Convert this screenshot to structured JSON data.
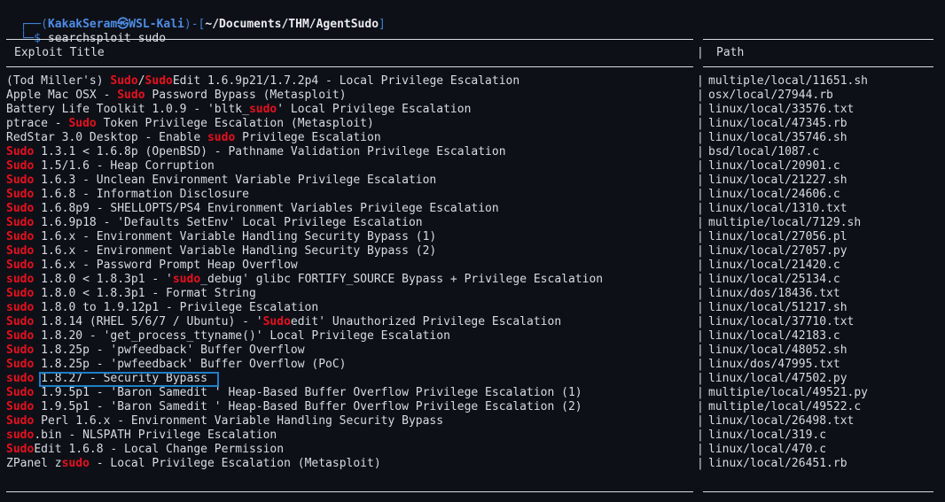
{
  "prompt": {
    "corner": "┌──(",
    "user": "KakakSeram",
    "at_glyph": "㉿",
    "host": "WSL-Kali",
    "mid": ")-[",
    "cwd": "~/Documents/THM/AgentSudo",
    "close": "]",
    "cmd_prefix": "└─$ ",
    "command": "searchsploit sudo"
  },
  "headers": {
    "title": "Exploit Title",
    "sep": "|",
    "path": "Path"
  },
  "rows": [
    {
      "parts": [
        [
          "(Tod Miller's) ",
          ""
        ],
        [
          "Sudo",
          "r"
        ],
        [
          "/",
          ""
        ],
        [
          "Sudo",
          "r"
        ],
        [
          "Edit 1.6.9p21/1.7.2p4 - Local Privilege Escalation",
          ""
        ]
      ],
      "path": "multiple/local/11651.sh"
    },
    {
      "parts": [
        [
          "Apple Mac OSX - ",
          ""
        ],
        [
          "Sudo",
          "r"
        ],
        [
          " Password Bypass (Metasploit)",
          ""
        ]
      ],
      "path": "osx/local/27944.rb"
    },
    {
      "parts": [
        [
          "Battery Life Toolkit 1.0.9 - 'bltk_",
          ""
        ],
        [
          "sudo",
          "r"
        ],
        [
          "' Local Privilege Escalation",
          ""
        ]
      ],
      "path": "linux/local/33576.txt"
    },
    {
      "parts": [
        [
          "ptrace - ",
          ""
        ],
        [
          "Sudo",
          "r"
        ],
        [
          " Token Privilege Escalation (Metasploit)",
          ""
        ]
      ],
      "path": "linux/local/47345.rb"
    },
    {
      "parts": [
        [
          "RedStar 3.0 Desktop - Enable ",
          ""
        ],
        [
          "sudo",
          "r"
        ],
        [
          " Privilege Escalation",
          ""
        ]
      ],
      "path": "linux/local/35746.sh"
    },
    {
      "parts": [
        [
          "Sudo",
          "r"
        ],
        [
          " 1.3.1 < 1.6.8p (OpenBSD) - Pathname Validation Privilege Escalation",
          ""
        ]
      ],
      "path": "bsd/local/1087.c"
    },
    {
      "parts": [
        [
          "Sudo",
          "r"
        ],
        [
          " 1.5/1.6 - Heap Corruption",
          ""
        ]
      ],
      "path": "linux/local/20901.c"
    },
    {
      "parts": [
        [
          "Sudo",
          "r"
        ],
        [
          " 1.6.3 - Unclean Environment Variable Privilege Escalation",
          ""
        ]
      ],
      "path": "linux/local/21227.sh"
    },
    {
      "parts": [
        [
          "Sudo",
          "r"
        ],
        [
          " 1.6.8 - Information Disclosure",
          ""
        ]
      ],
      "path": "linux/local/24606.c"
    },
    {
      "parts": [
        [
          "Sudo",
          "r"
        ],
        [
          " 1.6.8p9 - SHELLOPTS/PS4 Environment Variables Privilege Escalation",
          ""
        ]
      ],
      "path": "linux/local/1310.txt"
    },
    {
      "parts": [
        [
          "Sudo",
          "r"
        ],
        [
          " 1.6.9p18 - 'Defaults SetEnv' Local Privilege Escalation",
          ""
        ]
      ],
      "path": "multiple/local/7129.sh"
    },
    {
      "parts": [
        [
          "Sudo",
          "r"
        ],
        [
          " 1.6.x - Environment Variable Handling Security Bypass (1)",
          ""
        ]
      ],
      "path": "linux/local/27056.pl"
    },
    {
      "parts": [
        [
          "Sudo",
          "r"
        ],
        [
          " 1.6.x - Environment Variable Handling Security Bypass (2)",
          ""
        ]
      ],
      "path": "linux/local/27057.py"
    },
    {
      "parts": [
        [
          "Sudo",
          "r"
        ],
        [
          " 1.6.x - Password Prompt Heap Overflow",
          ""
        ]
      ],
      "path": "linux/local/21420.c"
    },
    {
      "parts": [
        [
          "sudo",
          "r"
        ],
        [
          " 1.8.0 < 1.8.3p1 - '",
          ""
        ],
        [
          "sudo",
          "r"
        ],
        [
          "_debug' glibc FORTIFY_SOURCE Bypass + Privilege Escalation",
          ""
        ]
      ],
      "path": "linux/local/25134.c"
    },
    {
      "parts": [
        [
          "Sudo",
          "r"
        ],
        [
          " 1.8.0 < 1.8.3p1 - Format String",
          ""
        ]
      ],
      "path": "linux/dos/18436.txt"
    },
    {
      "parts": [
        [
          "sudo",
          "r"
        ],
        [
          " 1.8.0 to 1.9.12p1 - Privilege Escalation",
          ""
        ]
      ],
      "path": "linux/local/51217.sh"
    },
    {
      "parts": [
        [
          "Sudo",
          "r"
        ],
        [
          " 1.8.14 (RHEL 5/6/7 / Ubuntu) - '",
          ""
        ],
        [
          "Sudo",
          "r"
        ],
        [
          "edit' Unauthorized Privilege Escalation",
          ""
        ]
      ],
      "path": "linux/local/37710.txt"
    },
    {
      "parts": [
        [
          "Sudo",
          "r"
        ],
        [
          " 1.8.20 - 'get_process_ttyname()' Local Privilege Escalation",
          ""
        ]
      ],
      "path": "linux/local/42183.c"
    },
    {
      "parts": [
        [
          "Sudo",
          "r"
        ],
        [
          " 1.8.25p - 'pwfeedback' Buffer Overflow",
          ""
        ]
      ],
      "path": "linux/local/48052.sh"
    },
    {
      "parts": [
        [
          "Sudo",
          "r"
        ],
        [
          " 1.8.25p - 'pwfeedback' Buffer Overflow (PoC)",
          ""
        ]
      ],
      "path": "linux/dos/47995.txt"
    },
    {
      "parts": [
        [
          "sudo",
          "r"
        ],
        [
          " 1.8.27 - Security Bypass",
          ""
        ]
      ],
      "path": "linux/local/47502.py",
      "highlight": true
    },
    {
      "parts": [
        [
          "Sudo",
          "r"
        ],
        [
          " 1.9.5p1 - 'Baron Samedit ' Heap-Based Buffer Overflow Privilege Escalation (1)",
          ""
        ]
      ],
      "path": "multiple/local/49521.py"
    },
    {
      "parts": [
        [
          "Sudo",
          "r"
        ],
        [
          " 1.9.5p1 - 'Baron Samedit ' Heap-Based Buffer Overflow Privilege Escalation (2)",
          ""
        ]
      ],
      "path": "multiple/local/49522.c"
    },
    {
      "parts": [
        [
          "Sudo",
          "r"
        ],
        [
          " Perl 1.6.x - Environment Variable Handling Security Bypass",
          ""
        ]
      ],
      "path": "linux/local/26498.txt"
    },
    {
      "parts": [
        [
          "sudo",
          "r"
        ],
        [
          ".bin - NLSPATH Privilege Escalation",
          ""
        ]
      ],
      "path": "linux/local/319.c"
    },
    {
      "parts": [
        [
          "Sudo",
          "r"
        ],
        [
          "Edit 1.6.8 - Local Change Permission",
          ""
        ]
      ],
      "path": "linux/local/470.c"
    },
    {
      "parts": [
        [
          "ZPanel z",
          ""
        ],
        [
          "sudo",
          "r"
        ],
        [
          " - Local Privilege Escalation (Metasploit)",
          ""
        ]
      ],
      "path": "linux/local/26451.rb"
    }
  ],
  "colors": {
    "background": "#0d1117",
    "keyword_red": "#e8101e",
    "highlight_box": "#1e7fc8",
    "prompt_blue": "#3f7fd6"
  }
}
